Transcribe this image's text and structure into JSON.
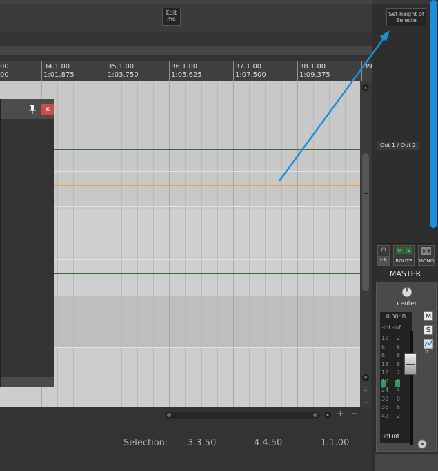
{
  "toolbar": {
    "edit_label": "Edit me"
  },
  "ruler": {
    "marks": [
      {
        "bar": "00",
        "time": "00"
      },
      {
        "bar": "34.1.00",
        "time": "1:01.875"
      },
      {
        "bar": "35.1.00",
        "time": "1:03.750"
      },
      {
        "bar": "36.1.00",
        "time": "1:05.625"
      },
      {
        "bar": "37.1.00",
        "time": "1:07.500"
      },
      {
        "bar": "38.1.00",
        "time": "1:09.375"
      },
      {
        "bar": "39",
        "time": ""
      }
    ]
  },
  "floating_window": {
    "close_label": "x"
  },
  "status": {
    "selection_label": "Selection:",
    "start": "3.3.50",
    "end": "4.4.50",
    "length": "1.1.00"
  },
  "right_panel": {
    "set_height_label": "Set height of Selecte",
    "output_label": "Out 1 / Out 2",
    "fx_label": "FX",
    "route_label": "ROUTE",
    "mono_label": "MONO",
    "m_label": "M",
    "s_label": "S",
    "master_label": "MASTER"
  },
  "master": {
    "pan_label": "center",
    "volume_readout": "0.00dB",
    "peak_left": "-inf",
    "peak_right": "-inf",
    "meter_scale_left": [
      "12",
      "6",
      "6",
      "18",
      "12",
      "18",
      "24",
      "30",
      "36",
      "42"
    ],
    "meter_scale_right": [
      "2",
      "6",
      "6",
      "8",
      "2",
      "8",
      "4",
      "0",
      "6",
      "2"
    ],
    "mute_label": "M",
    "solo_label": "S",
    "bottom_readout": "-inf-inf"
  },
  "colors": {
    "accent_blue": "#1d8fd8",
    "close_red": "#c94b4b",
    "track_line_orange": "#e8a040",
    "track_line_green": "#3a6a3a"
  }
}
